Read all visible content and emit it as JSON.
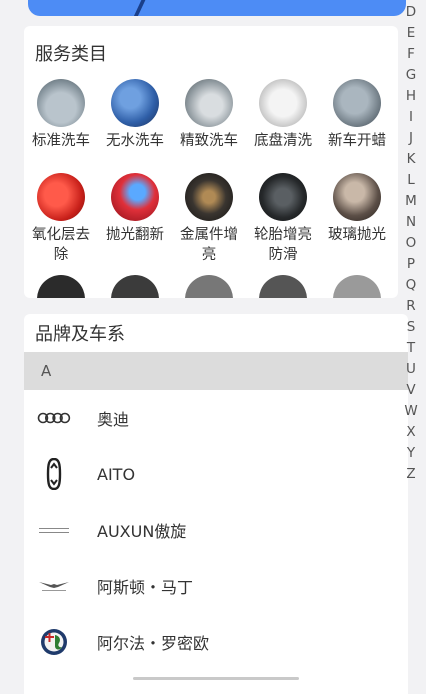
{
  "services": {
    "title": "服务类目",
    "items": [
      {
        "label": "标准洗车",
        "icon": "car-wash-standard-icon"
      },
      {
        "label": "无水洗车",
        "icon": "waterless-wash-icon"
      },
      {
        "label": "精致洗车",
        "icon": "fine-wash-icon"
      },
      {
        "label": "底盘清洗",
        "icon": "chassis-clean-icon"
      },
      {
        "label": "新车开蜡",
        "icon": "new-car-dewax-icon"
      },
      {
        "label": "氧化层去除",
        "icon": "oxidation-removal-icon"
      },
      {
        "label": "抛光翻新",
        "icon": "polish-refurbish-icon"
      },
      {
        "label": "金属件增亮",
        "icon": "metal-brighten-icon"
      },
      {
        "label": "轮胎增亮防滑",
        "icon": "tire-shine-icon"
      },
      {
        "label": "玻璃抛光",
        "icon": "glass-polish-icon"
      }
    ]
  },
  "brands": {
    "title": "品牌及车系",
    "current_letter": "A",
    "items": [
      {
        "name": "奥迪",
        "logo": "audi-logo"
      },
      {
        "name": "AITO",
        "logo": "aito-logo"
      },
      {
        "name": "AUXUN傲旋",
        "logo": "auxun-logo"
      },
      {
        "name": "阿斯顿・马丁",
        "logo": "aston-martin-logo"
      },
      {
        "name": "阿尔法・罗密欧",
        "logo": "alfa-romeo-logo"
      }
    ]
  },
  "alpha_index": [
    "D",
    "E",
    "F",
    "G",
    "H",
    "I",
    "J",
    "K",
    "L",
    "M",
    "N",
    "O",
    "P",
    "Q",
    "R",
    "S",
    "T",
    "U",
    "V",
    "W",
    "X",
    "Y",
    "Z"
  ],
  "colors": {
    "banner": "#4d8cf5",
    "letter_header": "#dcdcdc"
  }
}
